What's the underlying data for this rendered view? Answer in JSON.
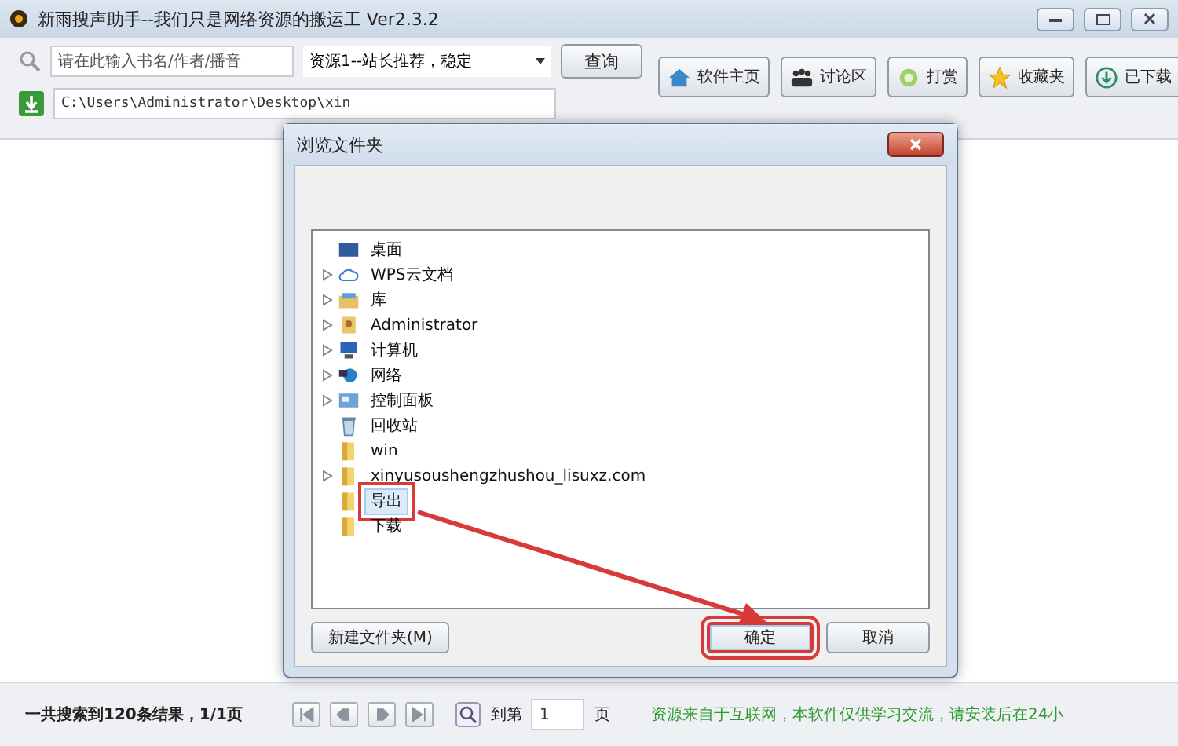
{
  "window": {
    "title": "新雨搜声助手--我们只是网络资源的搬运工 Ver2.3.2"
  },
  "search": {
    "placeholder": "请在此输入书名/作者/播音",
    "source": "资源1--站长推荐，稳定",
    "button": "查询"
  },
  "path": {
    "value": "C:\\Users\\Administrator\\Desktop\\xin"
  },
  "toolbar": [
    {
      "kind": "home",
      "label": "软件主页"
    },
    {
      "kind": "people",
      "label": "讨论区"
    },
    {
      "kind": "gift",
      "label": "打赏"
    },
    {
      "kind": "star",
      "label": "收藏夹"
    },
    {
      "kind": "download",
      "label": "已下载"
    }
  ],
  "dialog": {
    "title": "浏览文件夹",
    "tree": [
      {
        "label": "桌面",
        "kind": "desktop",
        "expandable": false,
        "selected": false,
        "highlighted": false,
        "children": [
          {
            "label": "WPS云文档",
            "kind": "cloud",
            "expandable": true,
            "selected": false,
            "highlighted": false
          },
          {
            "label": "库",
            "kind": "library",
            "expandable": true,
            "selected": false,
            "highlighted": false
          },
          {
            "label": "Administrator",
            "kind": "user",
            "expandable": true,
            "selected": false,
            "highlighted": false
          },
          {
            "label": "计算机",
            "kind": "computer",
            "expandable": true,
            "selected": false,
            "highlighted": false
          },
          {
            "label": "网络",
            "kind": "network",
            "expandable": true,
            "selected": false,
            "highlighted": false
          },
          {
            "label": "控制面板",
            "kind": "control-panel",
            "expandable": true,
            "selected": false,
            "highlighted": false
          },
          {
            "label": "回收站",
            "kind": "recycle",
            "expandable": false,
            "selected": false,
            "highlighted": false
          },
          {
            "label": "win",
            "kind": "folder",
            "expandable": false,
            "selected": false,
            "highlighted": false
          },
          {
            "label": "xinyusoushengzhushou_lisuxz.com",
            "kind": "folder",
            "expandable": true,
            "selected": false,
            "highlighted": false
          },
          {
            "label": "导出",
            "kind": "folder",
            "expandable": false,
            "selected": true,
            "highlighted": true
          },
          {
            "label": "下载",
            "kind": "folder",
            "expandable": false,
            "selected": false,
            "highlighted": false
          }
        ]
      }
    ],
    "new_folder_button": "新建文件夹(M)",
    "buttons": [
      {
        "label": "确定",
        "default": true,
        "highlighted": true
      },
      {
        "label": "取消",
        "default": false,
        "highlighted": false
      }
    ]
  },
  "status_bar": {
    "result": "一共搜索到120条结果，1/1页",
    "goto_prefix": "到第",
    "page": "1",
    "goto_suffix": "页",
    "notice": "资源来自于互联网，本软件仅供学习交流，请安装后在24小"
  }
}
